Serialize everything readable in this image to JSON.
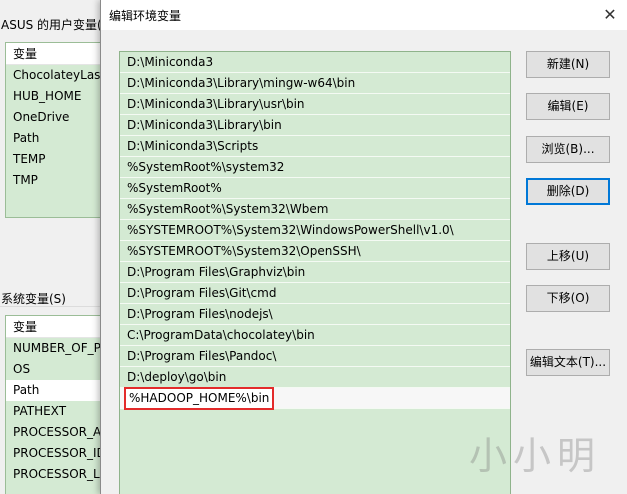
{
  "background": {
    "user_vars_label": "ASUS 的用户变量(",
    "user_vars": {
      "header": "变量",
      "rows": [
        "ChocolateyLast",
        "HUB_HOME",
        "OneDrive",
        "Path",
        "TEMP",
        "TMP"
      ]
    },
    "system_vars_label": "系统变量(S)",
    "system_vars": {
      "header": "变量",
      "rows": [
        "NUMBER_OF_P",
        "OS",
        "Path",
        "PATHEXT",
        "PROCESSOR_AI",
        "PROCESSOR_ID",
        "PROCESSOR_LE"
      ]
    }
  },
  "dialog": {
    "title": "编辑环境变量",
    "close_glyph": "✕",
    "paths": [
      "D:\\Miniconda3",
      "D:\\Miniconda3\\Library\\mingw-w64\\bin",
      "D:\\Miniconda3\\Library\\usr\\bin",
      "D:\\Miniconda3\\Library\\bin",
      "D:\\Miniconda3\\Scripts",
      "%SystemRoot%\\system32",
      "%SystemRoot%",
      "%SystemRoot%\\System32\\Wbem",
      "%SYSTEMROOT%\\System32\\WindowsPowerShell\\v1.0\\",
      "%SYSTEMROOT%\\System32\\OpenSSH\\",
      "D:\\Program Files\\Graphviz\\bin",
      "D:\\Program Files\\Git\\cmd",
      "D:\\Program Files\\nodejs\\",
      "C:\\ProgramData\\chocolatey\\bin",
      "D:\\Program Files\\Pandoc\\",
      "D:\\deploy\\go\\bin"
    ],
    "editing_value": "%HADOOP_HOME%\\bin",
    "buttons": {
      "new": "新建(N)",
      "edit": "编辑(E)",
      "browse": "浏览(B)...",
      "delete": "删除(D)",
      "move_up": "上移(U)",
      "move_down": "下移(O)",
      "edit_text": "编辑文本(T)..."
    }
  },
  "watermark": "小小明"
}
